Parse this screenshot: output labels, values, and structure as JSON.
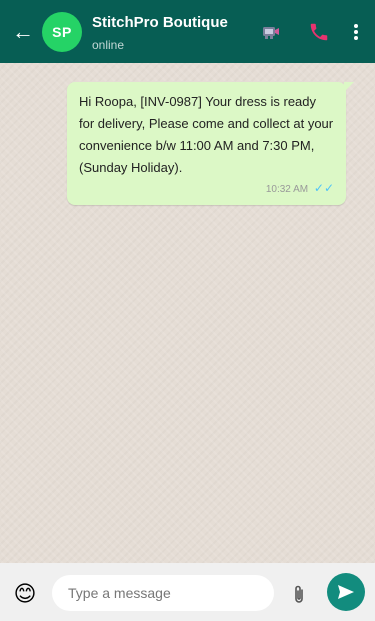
{
  "header": {
    "back_glyph": "←",
    "avatar_initials": "SP",
    "title": "StitchPro Boutique",
    "status": "online",
    "icons": [
      "video-call-icon",
      "phone-call-icon",
      "more-vert-icon"
    ],
    "bg_color": "#075e54",
    "avatar_color": "#25d366"
  },
  "chat": {
    "background_color": "#e5ddd5",
    "messages": [
      {
        "direction": "outgoing",
        "text": "Hi Roopa, [INV-0987] Your dress is ready for delivery, Please come and collect at your convenience b/w 11:00 AM and 7:30 PM,(Sunday Holiday).",
        "time": "10:32 AM",
        "ticks": "✓✓",
        "read_color": "#4fc3f7",
        "bubble_color": "#dcf8c6"
      }
    ]
  },
  "input_bar": {
    "emoji_glyph": "😊",
    "placeholder": "Type a message",
    "value": "",
    "attach_icon": "paperclip-icon",
    "send_icon": "send-icon",
    "send_color": "#128c7e"
  }
}
